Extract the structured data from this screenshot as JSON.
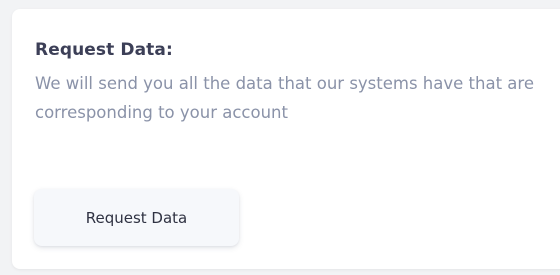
{
  "request_section": {
    "title": "Request Data:",
    "description": "We will send you all the data that our systems have that are corresponding to your account",
    "button_label": "Request Data"
  },
  "colors": {
    "page_background": "#f2f3f5",
    "card_background": "#ffffff",
    "title_color": "#3c3f57",
    "description_color": "#8a92a8",
    "button_background": "#f6f8fb",
    "button_text": "#2f3242"
  }
}
